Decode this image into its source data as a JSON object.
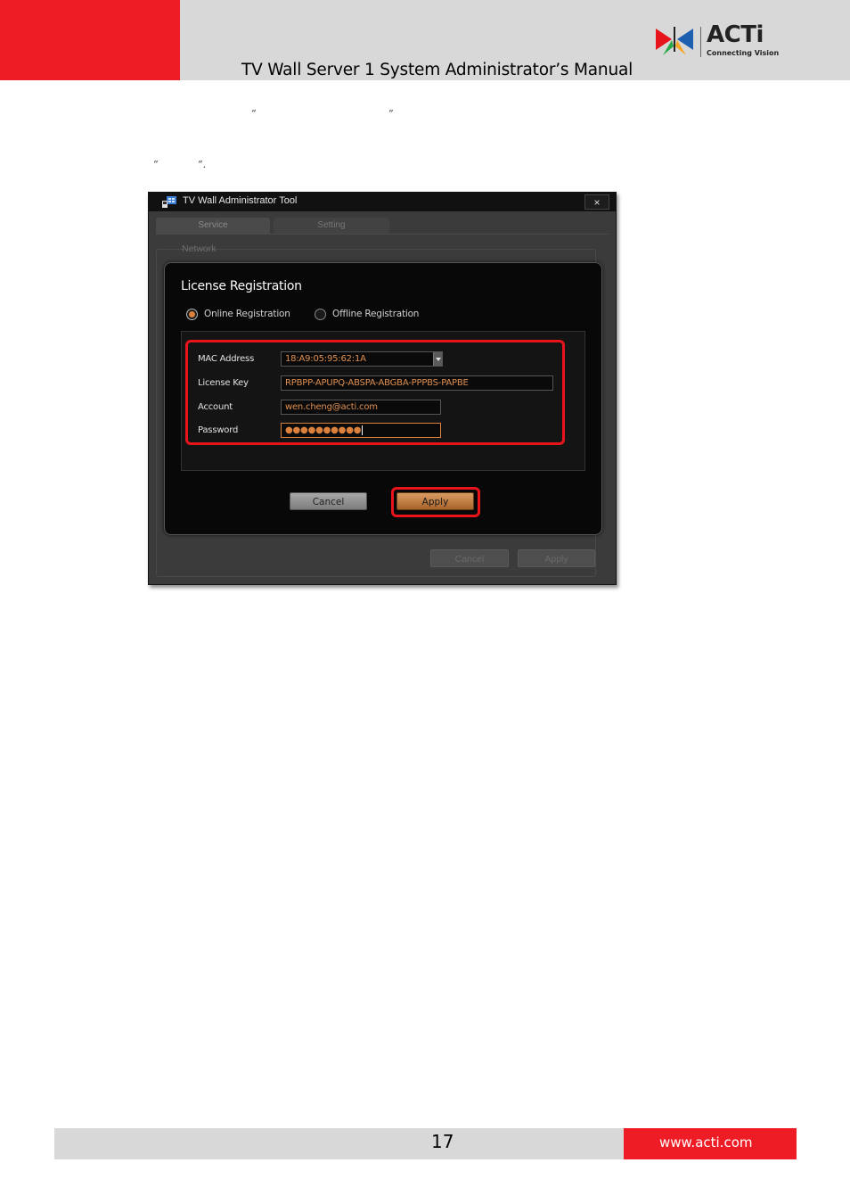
{
  "header": {
    "manual_title": "TV Wall Server 1 System Administrator’s Manual",
    "logo": {
      "name": "ACTi",
      "tagline": "Connecting Vision",
      "icon": "acti-butterfly-logo"
    }
  },
  "body_text": {
    "line1_open_quote": "“",
    "line1_close_quote": "”",
    "line2_open_quote": "“",
    "line2_close_quote": "”."
  },
  "window": {
    "title": "TV Wall Administrator Tool",
    "close_label": "×",
    "tabs": [
      {
        "label": "Service"
      },
      {
        "label": "Setting"
      }
    ],
    "group_label": "Network",
    "background_buttons": {
      "cancel": "Cancel",
      "apply": "Apply"
    }
  },
  "dialog": {
    "title": "License Registration",
    "options": [
      {
        "label": "Online Registration",
        "selected": true
      },
      {
        "label": "Offline Registration",
        "selected": false
      }
    ],
    "fields": {
      "mac_label": "MAC Address",
      "mac_value": "18:A9:05:95:62:1A",
      "license_label": "License Key",
      "license_value": "RPBPP-APUPQ-ABSPA-ABGBA-PPPBS-PAPBE",
      "account_label": "Account",
      "account_value": "wen.cheng@acti.com",
      "password_label": "Password",
      "password_value": "●●●●●●●●●●"
    },
    "buttons": {
      "cancel": "Cancel",
      "apply": "Apply"
    }
  },
  "colors": {
    "brand_red": "#ee1c25",
    "accent_orange": "#d9813d",
    "highlight_red": "#e8141c"
  },
  "footer": {
    "page_number": "17",
    "website": "www.acti.com"
  }
}
